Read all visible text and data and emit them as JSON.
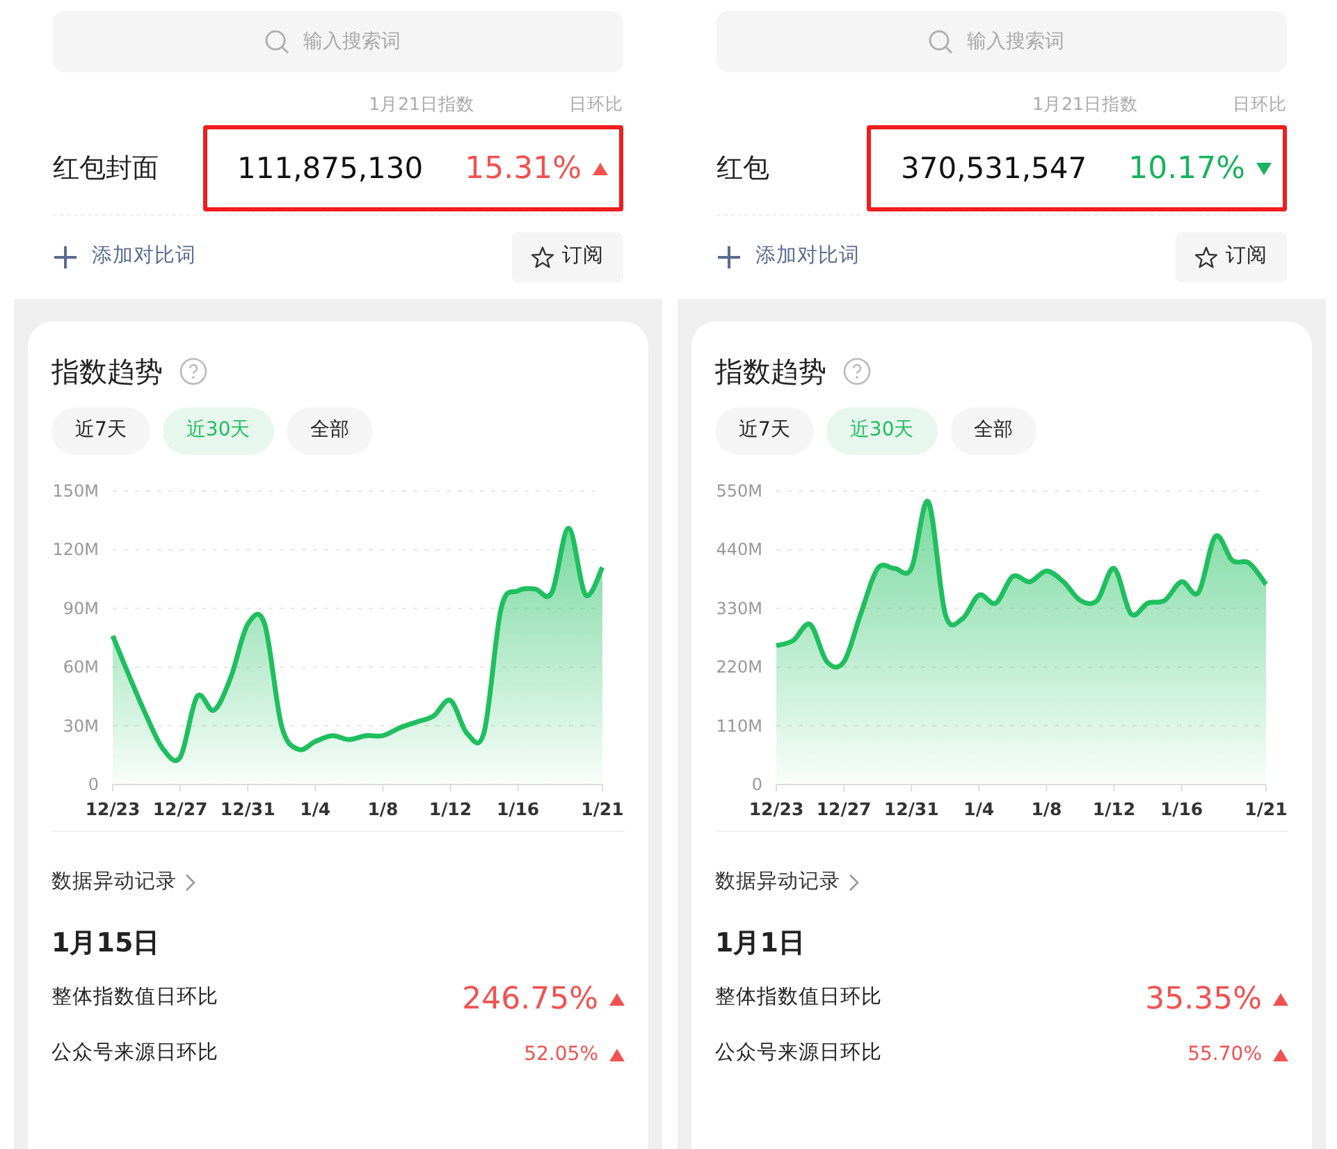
{
  "panels": [
    {
      "search": {
        "placeholder": "输入搜索词"
      },
      "header": {
        "index_label": "1月21日指数",
        "change_label": "日环比"
      },
      "keyword": {
        "name": "红包封面",
        "value": "111,875,130",
        "change": "15.31%",
        "rising": true,
        "highlighted": true
      },
      "add_compare": "添加对比词",
      "subscribe": "订阅",
      "trend": {
        "title": "指数趋势",
        "ranges": [
          {
            "label": "近7天",
            "selected": false
          },
          {
            "label": "近30天",
            "selected": true
          },
          {
            "label": "全部",
            "selected": false
          }
        ],
        "chart_data": {
          "type": "area",
          "categories": [
            "12/23",
            null,
            null,
            null,
            "12/27",
            null,
            null,
            null,
            "12/31",
            null,
            null,
            null,
            "1/4",
            null,
            null,
            null,
            "1/8",
            null,
            null,
            null,
            "1/12",
            null,
            null,
            null,
            "1/16",
            null,
            null,
            null,
            null,
            "1/21"
          ],
          "series": [
            {
              "color": "#1fbf5f",
              "values": [
                76,
                55,
                35,
                18,
                14,
                45,
                38,
                55,
                82,
                82,
                30,
                18,
                22,
                25,
                23,
                25,
                25,
                29,
                32,
                35,
                43,
                26,
                27,
                90,
                99,
                100,
                98,
                131,
                97,
                111
              ]
            }
          ],
          "ylim": [
            0,
            150
          ],
          "grid": true,
          "yticks": [
            {
              "value": 0,
              "label": "0"
            },
            {
              "value": 30,
              "label": "30M"
            },
            {
              "value": 60,
              "label": "60M"
            },
            {
              "value": 90,
              "label": "90M"
            },
            {
              "value": 120,
              "label": "120M"
            },
            {
              "value": 150,
              "label": "150M"
            }
          ]
        }
      },
      "records": {
        "title": "数据异动记录",
        "date": "1月15日",
        "rows": [
          {
            "kind": "major",
            "label": "整体指数值日环比",
            "value": "246.75%",
            "rising": true
          },
          {
            "kind": "minor",
            "label": "公众号来源日环比",
            "value": "52.05%",
            "rising": true
          }
        ]
      }
    },
    {
      "search": {
        "placeholder": "输入搜索词"
      },
      "header": {
        "index_label": "1月21日指数",
        "change_label": "日环比"
      },
      "keyword": {
        "name": "红包",
        "value": "370,531,547",
        "change": "10.17%",
        "rising": false,
        "highlighted": true
      },
      "add_compare": "添加对比词",
      "subscribe": "订阅",
      "trend": {
        "title": "指数趋势",
        "ranges": [
          {
            "label": "近7天",
            "selected": false
          },
          {
            "label": "近30天",
            "selected": true
          },
          {
            "label": "全部",
            "selected": false
          }
        ],
        "chart_data": {
          "type": "area",
          "categories": [
            "12/23",
            null,
            null,
            null,
            "12/27",
            null,
            null,
            null,
            "12/31",
            null,
            null,
            null,
            "1/4",
            null,
            null,
            null,
            "1/8",
            null,
            null,
            null,
            "1/12",
            null,
            null,
            null,
            "1/16",
            null,
            null,
            null,
            null,
            "1/21"
          ],
          "series": [
            {
              "color": "#1fbf5f",
              "values": [
                260,
                270,
                300,
                230,
                230,
                320,
                405,
                405,
                405,
                530,
                320,
                310,
                355,
                340,
                390,
                380,
                400,
                380,
                345,
                345,
                405,
                320,
                340,
                345,
                380,
                360,
                465,
                420,
                415,
                375
              ]
            }
          ],
          "ylim": [
            0,
            550
          ],
          "grid": true,
          "yticks": [
            {
              "value": 0,
              "label": "0"
            },
            {
              "value": 110,
              "label": "110M"
            },
            {
              "value": 220,
              "label": "220M"
            },
            {
              "value": 330,
              "label": "330M"
            },
            {
              "value": 440,
              "label": "440M"
            },
            {
              "value": 550,
              "label": "550M"
            }
          ]
        }
      },
      "records": {
        "title": "数据异动记录",
        "date": "1月1日",
        "rows": [
          {
            "kind": "major",
            "label": "整体指数值日环比",
            "value": "35.35%",
            "rising": true
          },
          {
            "kind": "minor",
            "label": "公众号来源日环比",
            "value": "55.70%",
            "rising": true
          }
        ]
      }
    }
  ]
}
